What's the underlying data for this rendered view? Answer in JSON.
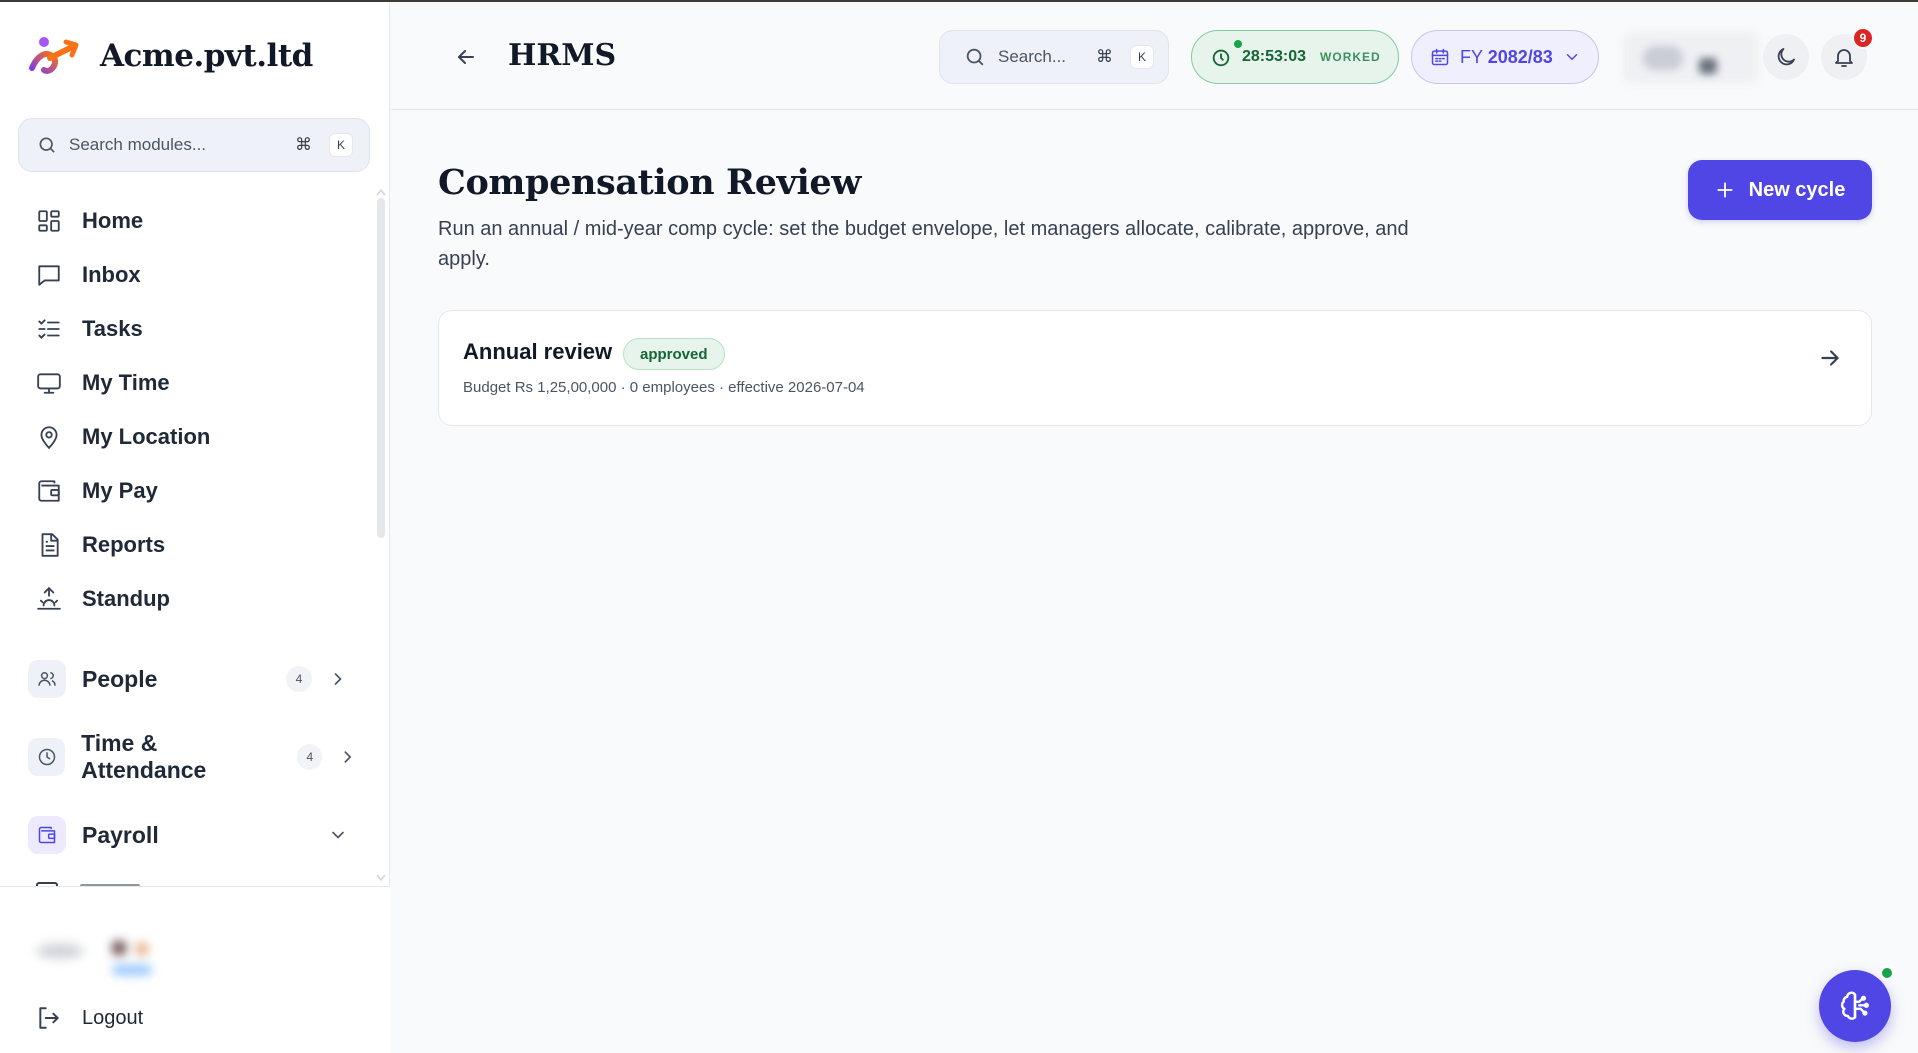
{
  "brand": {
    "name": "Acme.pvt.ltd"
  },
  "sidebar": {
    "search": {
      "placeholder": "Search modules...",
      "kbd_cmd": "⌘",
      "kbd_key": "K"
    },
    "items": [
      {
        "label": "Home",
        "icon": "grid-icon"
      },
      {
        "label": "Inbox",
        "icon": "message-icon"
      },
      {
        "label": "Tasks",
        "icon": "checklist-icon"
      },
      {
        "label": "My Time",
        "icon": "monitor-icon"
      },
      {
        "label": "My Location",
        "icon": "map-pin-icon"
      },
      {
        "label": "My Pay",
        "icon": "wallet-icon"
      },
      {
        "label": "Reports",
        "icon": "document-icon"
      },
      {
        "label": "Standup",
        "icon": "sunrise-icon"
      }
    ],
    "groups": {
      "people": {
        "label": "People",
        "count": "4"
      },
      "time": {
        "label": "Time & Attendance",
        "count": "4"
      },
      "payroll": {
        "label": "Payroll"
      }
    },
    "logout_label": "Logout"
  },
  "topbar": {
    "title": "HRMS",
    "search": {
      "placeholder": "Search...",
      "kbd_cmd": "⌘",
      "kbd_key": "K"
    },
    "worked": {
      "time": "28:53:03",
      "label": "WORKED"
    },
    "fy": {
      "prefix": "FY",
      "value": "2082/83"
    },
    "notifications": "9"
  },
  "main": {
    "title": "Compensation Review",
    "description": "Run an annual / mid-year comp cycle: set the budget envelope, let managers allocate, calibrate, approve, and apply.",
    "new_button": "New cycle",
    "cycles": [
      {
        "name": "Annual review",
        "status": "approved",
        "meta": "Budget Rs 1,25,00,000 · 0 employees · effective 2026-07-04"
      }
    ]
  },
  "colors": {
    "accent": "#4f46e5",
    "success": "#166534",
    "danger": "#dc2626"
  }
}
